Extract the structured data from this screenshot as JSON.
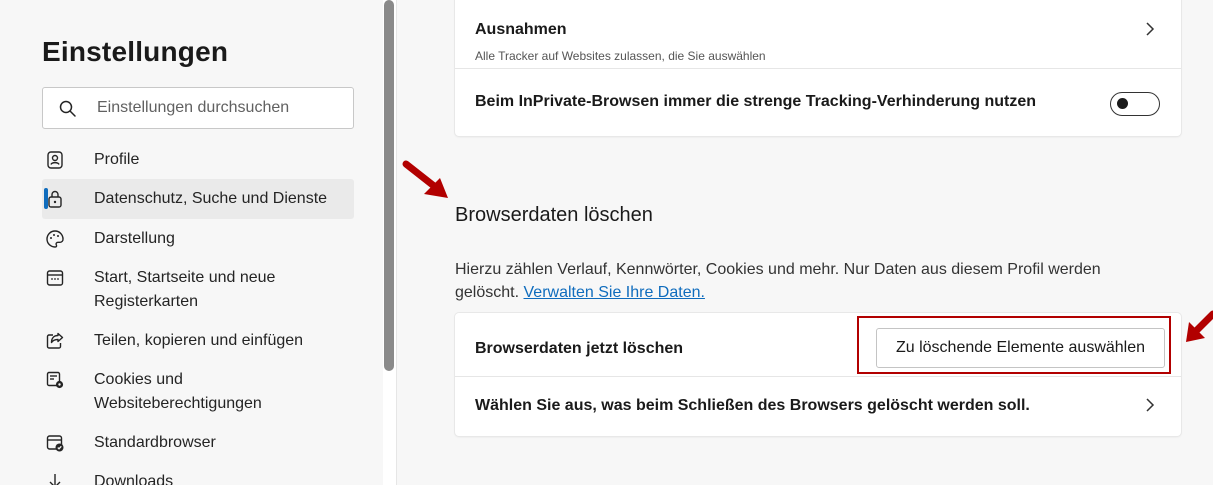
{
  "sidebar": {
    "title": "Einstellungen",
    "search_placeholder": "Einstellungen durchsuchen",
    "items": [
      {
        "label": "Profile",
        "icon": "profile-icon"
      },
      {
        "label": "Datenschutz, Suche und Dienste",
        "icon": "lock-icon",
        "active": true
      },
      {
        "label": "Darstellung",
        "icon": "palette-icon"
      },
      {
        "label": "Start, Startseite und neue Registerkarten",
        "icon": "new-tab-icon"
      },
      {
        "label": "Teilen, kopieren und einfügen",
        "icon": "share-icon"
      },
      {
        "label": "Cookies und Websiteberechtigungen",
        "icon": "cookies-settings-icon"
      },
      {
        "label": "Standardbrowser",
        "icon": "default-browser-icon"
      },
      {
        "label": "Downloads",
        "icon": "download-icon"
      }
    ]
  },
  "tracking": {
    "exceptions_title": "Ausnahmen",
    "exceptions_sub": "Alle Tracker auf Websites zulassen, die Sie auswählen",
    "inprivate_label": "Beim InPrivate-Browsen immer die strenge Tracking-Verhinderung nutzen",
    "inprivate_toggle": "off"
  },
  "clear_data": {
    "section_title": "Browserdaten löschen",
    "description": "Hierzu zählen Verlauf, Kennwörter, Cookies und mehr. Nur Daten aus diesem Profil werden gelöscht.",
    "manage_link": "Verwalten Sie Ihre Daten.",
    "clear_now_label": "Browserdaten jetzt löschen",
    "choose_button": "Zu löschende Elemente auswählen",
    "on_close_label": "Wählen Sie aus, was beim Schließen des Browsers gelöscht werden soll."
  },
  "colors": {
    "accent": "#0f6cbd",
    "annotation": "#b20000"
  }
}
